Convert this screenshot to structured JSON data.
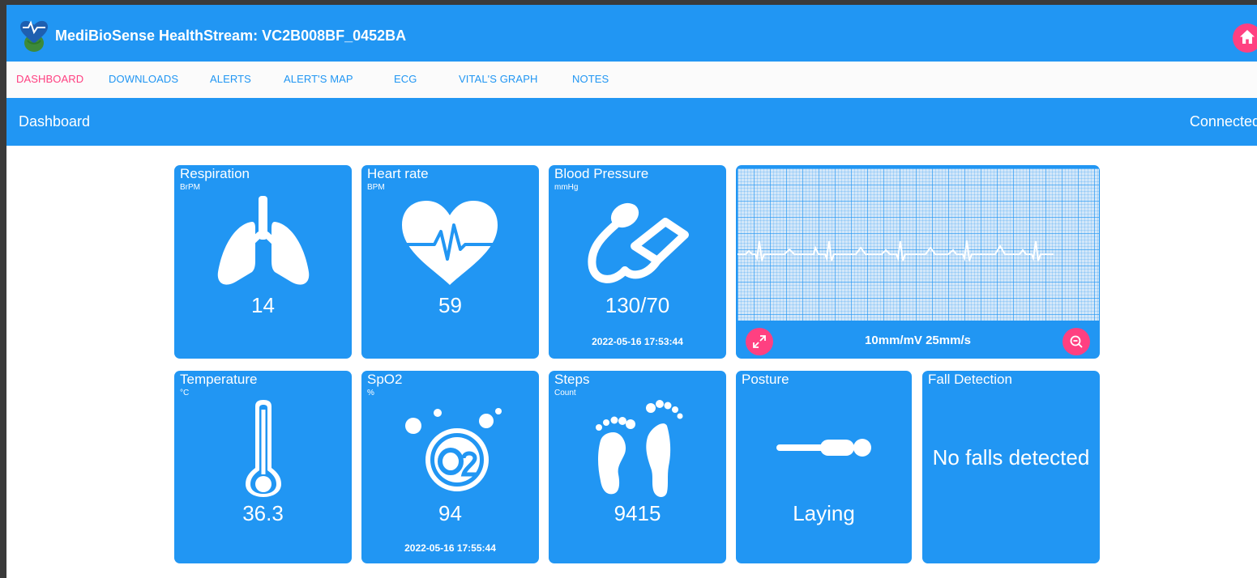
{
  "app": {
    "title": "MediBioSense HealthStream: VC2B008BF_0452BA",
    "logo_icon": "heart-globe-logo",
    "home_icon": "home-icon"
  },
  "nav": {
    "items": [
      {
        "label": "DASHBOARD",
        "active": true
      },
      {
        "label": "DOWNLOADS",
        "active": false
      },
      {
        "label": "ALERTS",
        "active": false
      },
      {
        "label": "ALERT'S MAP",
        "active": false
      },
      {
        "label": "ECG",
        "active": false
      },
      {
        "label": "VITAL'S GRAPH",
        "active": false
      },
      {
        "label": "NOTES",
        "active": false
      }
    ]
  },
  "header": {
    "title": "Dashboard",
    "status": "Connected"
  },
  "cards": {
    "respiration": {
      "title": "Respiration",
      "unit": "BrPM",
      "value": "14",
      "icon": "lungs-icon"
    },
    "heart_rate": {
      "title": "Heart rate",
      "unit": "BPM",
      "value": "59",
      "icon": "heart-pulse-icon"
    },
    "blood_pressure": {
      "title": "Blood Pressure",
      "unit": "mmHg",
      "value": "130/70",
      "timestamp": "2022-05-16 17:53:44",
      "icon": "blood-pressure-cuff-icon"
    },
    "ecg": {
      "scale": "10mm/mV 25mm/s",
      "expand_icon": "expand-icon",
      "zoom_icon": "zoom-out-icon"
    },
    "temperature": {
      "title": "Temperature",
      "unit": "°C",
      "value": "36.3",
      "icon": "thermometer-icon"
    },
    "spo2": {
      "title": "SpO2",
      "unit": "%",
      "value": "94",
      "timestamp": "2022-05-16 17:55:44",
      "icon": "o2-icon"
    },
    "steps": {
      "title": "Steps",
      "unit": "Count",
      "value": "9415",
      "icon": "footprints-icon"
    },
    "posture": {
      "title": "Posture",
      "value": "Laying",
      "icon": "posture-laying-icon"
    },
    "fall_detection": {
      "title": "Fall Detection",
      "value": "No falls detected"
    }
  },
  "colors": {
    "primary": "#2196f3",
    "accent": "#ff4081",
    "background": "#ffffff",
    "ecg_grid": "#d3e7f9"
  }
}
